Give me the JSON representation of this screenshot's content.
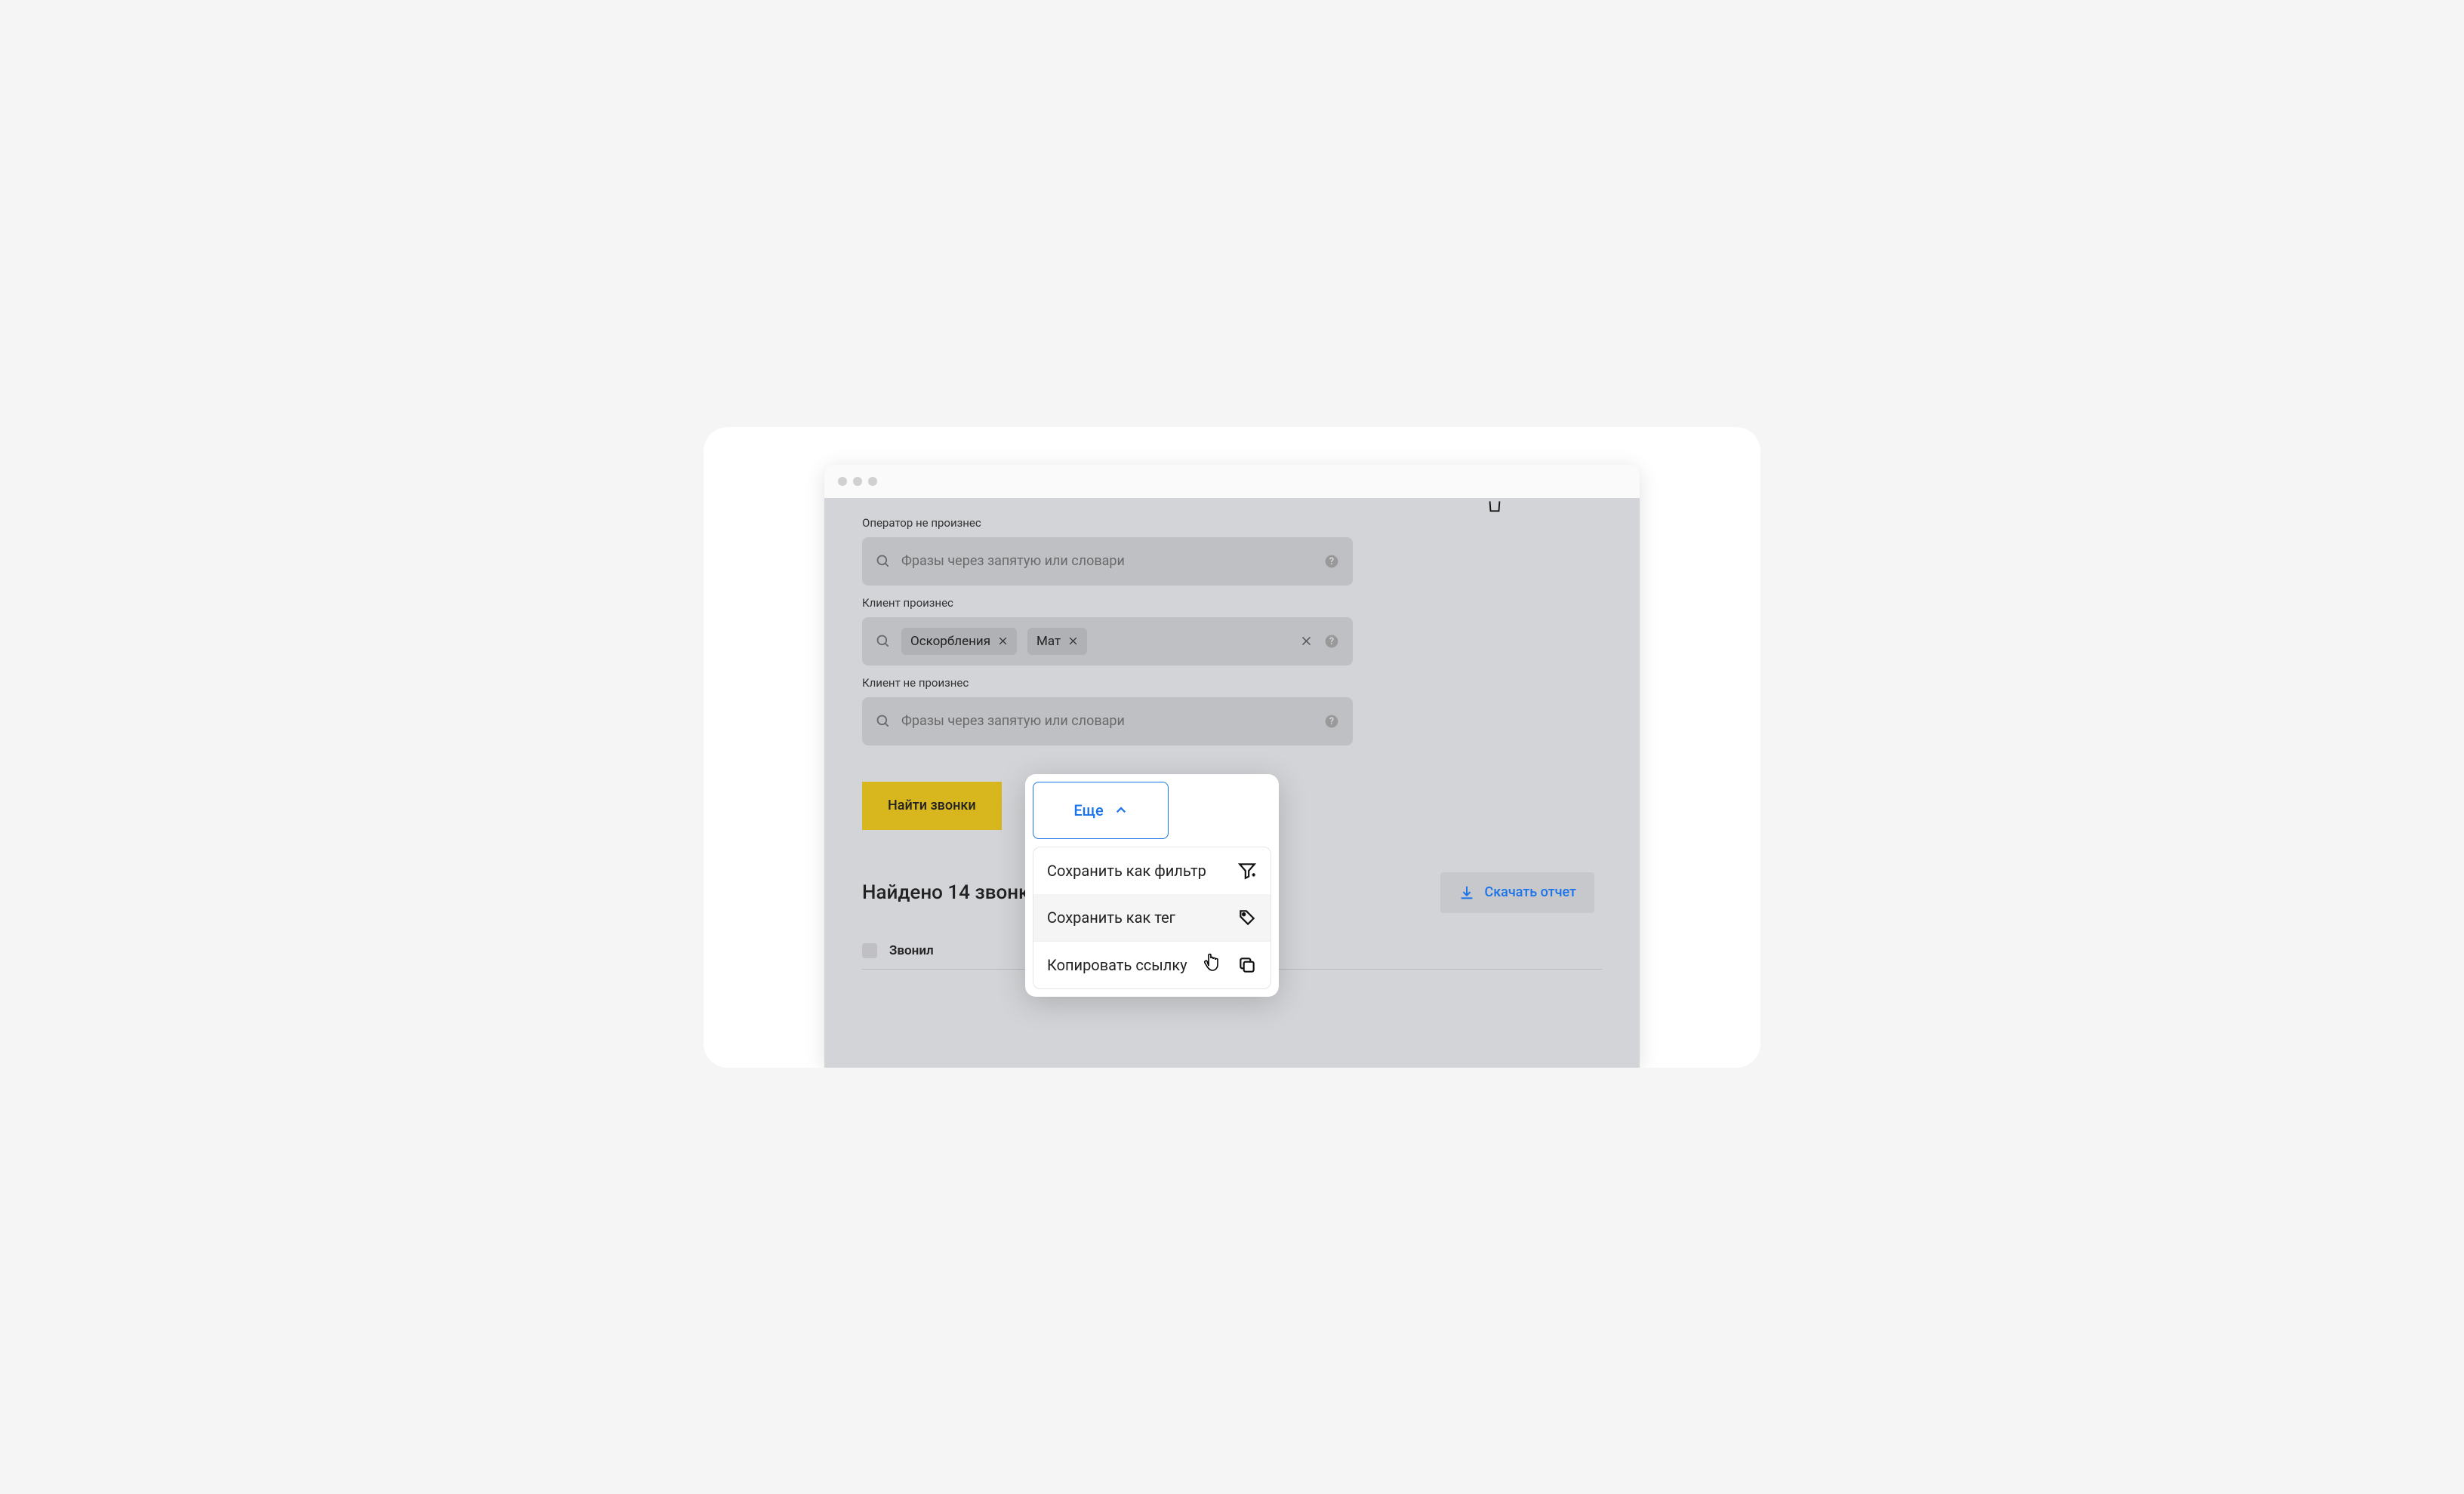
{
  "filters": {
    "operator_not_said": {
      "label": "Оператор не произнес",
      "placeholder": "Фразы через запятую или словари"
    },
    "client_said": {
      "label": "Клиент произнес",
      "tags": [
        "Оскорбления",
        "Мат"
      ]
    },
    "client_not_said": {
      "label": "Клиент не произнес",
      "placeholder": "Фразы через запятую или словари"
    }
  },
  "actions": {
    "find_calls": "Найти звонки",
    "more": "Еще"
  },
  "dropdown": {
    "save_as_filter": "Сохранить как фильтр",
    "save_as_tag": "Сохранить как тег",
    "copy_link": "Копировать ссылку"
  },
  "results": {
    "label_prefix": "Найдено ",
    "count": "14",
    "label_suffix": " звонки",
    "download": "Скачать отчет"
  },
  "table": {
    "col_caller": "Звонил"
  }
}
